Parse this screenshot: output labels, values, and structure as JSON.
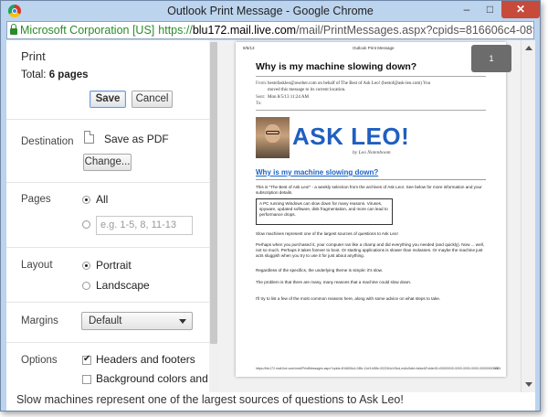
{
  "window": {
    "title": "Outlook Print Message - Google Chrome",
    "controls": {
      "minimize": "–",
      "maximize": "□",
      "close": "✕"
    }
  },
  "address": {
    "identity": "Microsoft Corporation [US]",
    "scheme": "https://",
    "host": "blu172.mail.live.com",
    "path": "/mail/PrintMessages.aspx?cpids=816606c4-08fc-11e"
  },
  "print": {
    "title": "Print",
    "total_label": "Total:",
    "total_value": "6 pages",
    "save": "Save",
    "cancel": "Cancel",
    "destination": {
      "label": "Destination",
      "value": "Save as PDF",
      "change": "Change..."
    },
    "pages": {
      "label": "Pages",
      "all": "All",
      "placeholder": "e.g. 1-5, 8, 11-13"
    },
    "layout": {
      "label": "Layout",
      "portrait": "Portrait",
      "landscape": "Landscape"
    },
    "margins": {
      "label": "Margins",
      "value": "Default"
    },
    "options": {
      "label": "Options",
      "headers": "Headers and footers",
      "background": "Background colors and"
    }
  },
  "preview": {
    "page_badge": "1",
    "page": {
      "hdr_left": "8/5/13",
      "hdr_center": "Outlook Print Message",
      "title": "Why is my machine slowing down?",
      "from_label": "From:",
      "from_value": "bestofaskleo@aweber.com on behalf of The Best of Ask Leo! (bestof@ask-leo.com)    You",
      "from_value2": "moved this message to its current location.",
      "sent_label": "Sent:",
      "sent_value": "Mon 8/5/13 11:24 AM",
      "to_label": "To:",
      "logo": "ASK LEO!",
      "logo_sub": "by Leo Notenboom",
      "link": "Why is my machine slowing down?",
      "intro": "This is \"The Best of Ask Leo!\" - a weekly selection from the archives of Ask Leo!. See below for more information and your subscription details.",
      "box": "A PC running Windows can slow down for many reasons. Viruses, spyware, updated software, disk fragmentation, and more can lead to performance drops.",
      "p1": "Slow machines represent one of the largest sources of questions to Ask Leo!",
      "p2": "Perhaps when you purchased it, your computer ran like a champ and did everything you needed (and quickly). Now ... well, not so much. Perhaps it takes forever to boot. Or starting applications is slower than molasses. Or maybe the machine just acts sluggish when you try to use it for just about anything.",
      "p3": "Regardless of the specifics, the underlying theme is simple: it's slow.",
      "p4": "The problem is that there are many, many reasons that a machine could slow down.",
      "p5": "I'll try to list a few of the most common reasons here, along with some advice on what steps to take.",
      "footer": "https://blu172.mail.live.com/mail/PrintMessages.aspx?cpids=816606c4-08fc-11e3-b58e-002264c1f0cd,m&isSafe=false&FolderID=00000000-0000-0000-0000-000000000001",
      "page_num": "1/6"
    }
  },
  "status_line": "Slow machines represent one of the largest sources of questions to Ask Leo!"
}
